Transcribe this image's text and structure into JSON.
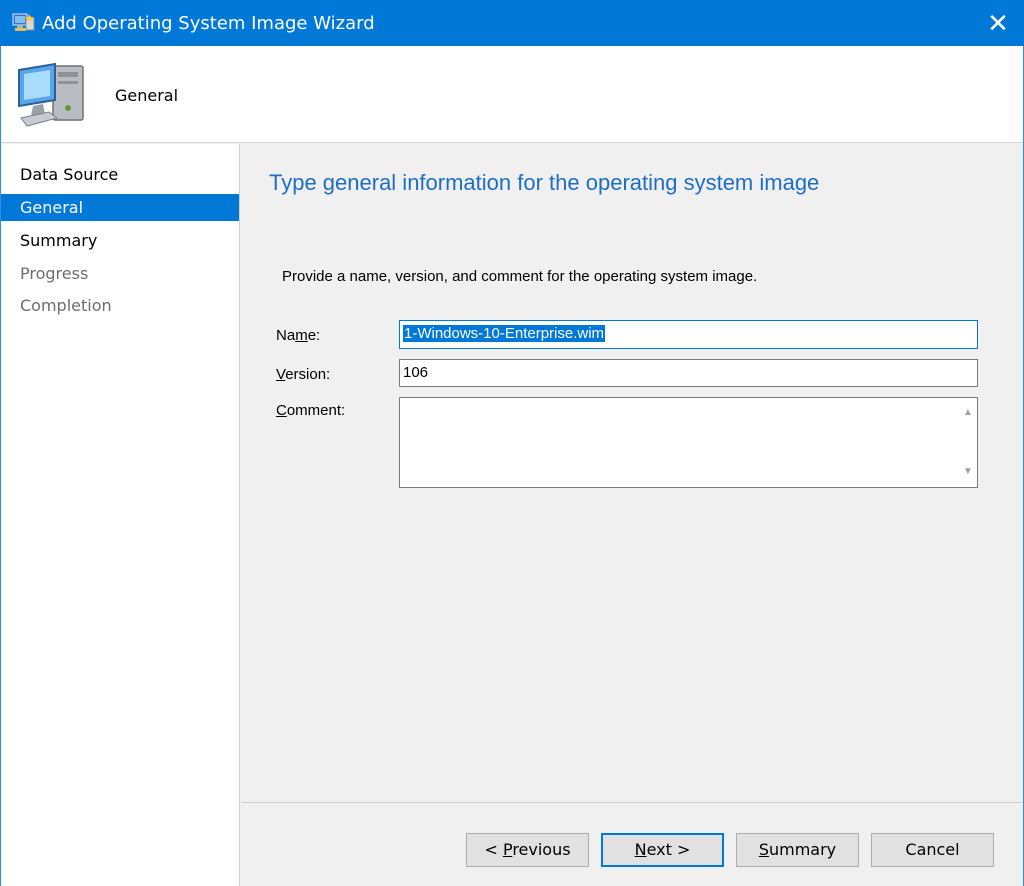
{
  "window": {
    "title": "Add Operating System Image Wizard",
    "close_glyph": "✕"
  },
  "header": {
    "title": "General",
    "icon": "computer-icon"
  },
  "sidebar": {
    "items": [
      {
        "label": "Data Source",
        "state": "normal"
      },
      {
        "label": "General",
        "state": "active"
      },
      {
        "label": "Summary",
        "state": "normal"
      },
      {
        "label": "Progress",
        "state": "disabled"
      },
      {
        "label": "Completion",
        "state": "disabled"
      }
    ]
  },
  "main": {
    "heading": "Type general information for the operating system image",
    "instructions": "Provide a name, version, and comment for the operating system image.",
    "fields": {
      "name": {
        "label_pre": "Na",
        "label_mnemonic": "m",
        "label_post": "e:",
        "value": "1-Windows-10-Enterprise.wim"
      },
      "version": {
        "label_pre": "",
        "label_mnemonic": "V",
        "label_post": "ersion:",
        "value": "106"
      },
      "comment": {
        "label_pre": "",
        "label_mnemonic": "C",
        "label_post": "omment:",
        "value": ""
      }
    }
  },
  "buttons": {
    "previous": {
      "pre": "< ",
      "mnemonic": "P",
      "post": "revious"
    },
    "next": {
      "pre": "",
      "mnemonic": "N",
      "post": "ext >"
    },
    "summary": {
      "pre": "",
      "mnemonic": "S",
      "post": "ummary"
    },
    "cancel": {
      "pre": "",
      "mnemonic": "",
      "post": "Cancel"
    }
  },
  "colors": {
    "accent": "#0078d7",
    "heading": "#1e6ec8"
  }
}
